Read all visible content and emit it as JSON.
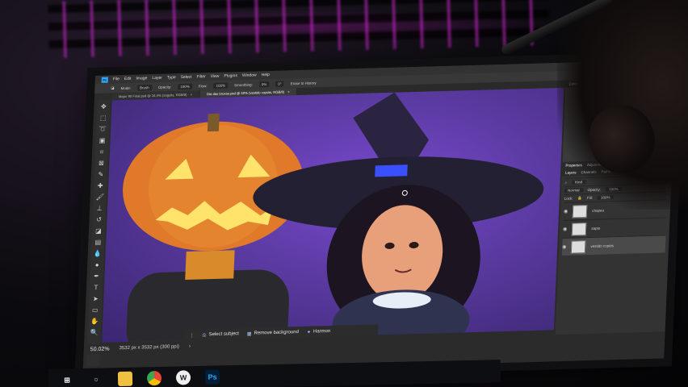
{
  "app": {
    "menu": [
      "File",
      "Edit",
      "Image",
      "Layer",
      "Type",
      "Select",
      "Filter",
      "View",
      "Plugins",
      "Window",
      "Help"
    ],
    "logo_text": "Ps"
  },
  "options_bar": {
    "mode_label": "Mode:",
    "mode_value": "Brush",
    "opacity_label": "Opacity:",
    "opacity_value": "100%",
    "flow_label": "Flow:",
    "flow_value": "100%",
    "smoothing_label": "Smoothing:",
    "smoothing_value": "0%",
    "angle_value": "0°",
    "erase_history_label": "Erase to History"
  },
  "tabs": [
    {
      "label": "Major 90 Final.psd @ 34,4% (sagulis, RGB/8)",
      "active": false
    },
    {
      "label": "Dia das bruxas.psd @ 50% (vestido copias, RGB/8)",
      "active": true
    }
  ],
  "context_bar": {
    "select_subject": "Select subject",
    "remove_background": "Remove background",
    "harmonize": "Harmon"
  },
  "status_bar": {
    "zoom": "50.02%",
    "doc_size": "3532 px x 3532 px (300 ppi)"
  },
  "right_panel": {
    "color_tabs": [
      "Color",
      "Swatches",
      "Gradients"
    ],
    "properties_tabs": [
      "Properties",
      "Adjustments",
      "Libraries"
    ],
    "layer_tabs": [
      "Layers",
      "Channels",
      "Paths"
    ],
    "kind_label": "Kind",
    "blend_mode": "Normal",
    "opacity_label": "Opacity:",
    "opacity_value": "100%",
    "lock_label": "Lock:",
    "fill_label": "Fill:",
    "fill_value": "100%",
    "layers": [
      {
        "name": "chapeu",
        "selected": false
      },
      {
        "name": "sapto",
        "selected": false
      },
      {
        "name": "vestido copias",
        "selected": true
      }
    ]
  },
  "taskbar": {
    "apps": [
      "windows-start",
      "search",
      "file-explorer",
      "chrome",
      "wacom",
      "photoshop"
    ],
    "photoshop_label": "Ps",
    "wacom_label": "W"
  },
  "colors": {
    "accent": "#31a8ff",
    "canvas_bg": "#5a3aa0",
    "pumpkin": "#e07a2a",
    "hat": "#2a2440"
  }
}
